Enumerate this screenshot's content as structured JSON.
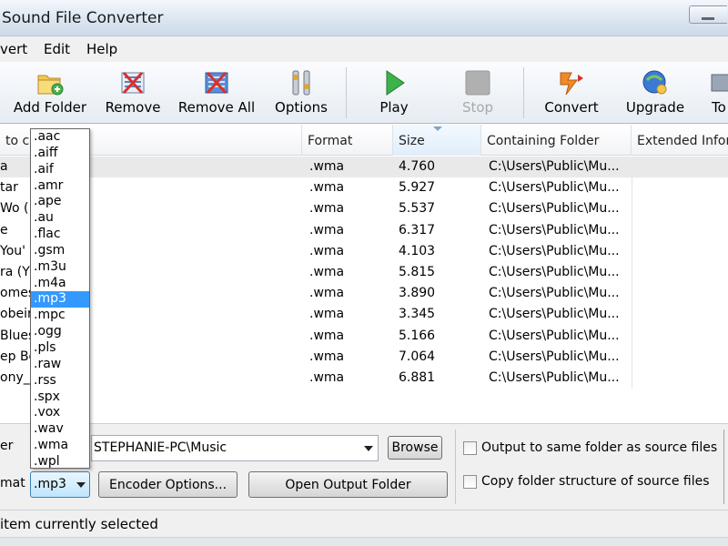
{
  "window": {
    "title": "Sound File Converter"
  },
  "menu": [
    "vert",
    "Edit",
    "Help"
  ],
  "toolbar": {
    "add_folder": "Add Folder",
    "remove": "Remove",
    "remove_all": "Remove All",
    "options": "Options",
    "play": "Play",
    "stop": "Stop",
    "convert": "Convert",
    "upgrade": "Upgrade",
    "tools_partial": "To"
  },
  "list": {
    "headers": {
      "name": "to co",
      "format": "Format",
      "size": "Size",
      "folder": "Containing Folder",
      "extended": "Extended Infor"
    },
    "rows": [
      {
        "name": "a",
        "format": ".wma",
        "size": "4.760",
        "folder": "C:\\Users\\Public\\Mu...",
        "selected": true
      },
      {
        "name": "tar",
        "format": ".wma",
        "size": "5.927",
        "folder": "C:\\Users\\Public\\Mu..."
      },
      {
        "name": "Wo (",
        "format": ".wma",
        "size": "5.537",
        "folder": "C:\\Users\\Public\\Mu..."
      },
      {
        "name": "e",
        "format": ".wma",
        "size": "6.317",
        "folder": "C:\\Users\\Public\\Mu..."
      },
      {
        "name": "You'",
        "format": ".wma",
        "size": "4.103",
        "folder": "C:\\Users\\Public\\Mu..."
      },
      {
        "name": "ra (Y",
        "format": ".wma",
        "size": "5.815",
        "folder": "C:\\Users\\Public\\Mu..."
      },
      {
        "name": "omes",
        "format": ".wma",
        "size": "3.890",
        "folder": "C:\\Users\\Public\\Mu..."
      },
      {
        "name": "obeir",
        "format": ".wma",
        "size": "3.345",
        "folder": "C:\\Users\\Public\\Mu..."
      },
      {
        "name": "Blues",
        "format": ".wma",
        "size": "5.166",
        "folder": "C:\\Users\\Public\\Mu..."
      },
      {
        "name": "ep Be",
        "format": ".wma",
        "size": "7.064",
        "folder": "C:\\Users\\Public\\Mu..."
      },
      {
        "name": "ony_N",
        "format": ".wma",
        "size": "6.881",
        "folder": "C:\\Users\\Public\\Mu..."
      }
    ]
  },
  "format_dropdown": {
    "options": [
      ".aac",
      ".aiff",
      ".aif",
      ".amr",
      ".ape",
      ".au",
      ".flac",
      ".gsm",
      ".m3u",
      ".m4a",
      ".mp3",
      ".mpc",
      ".ogg",
      ".pls",
      ".raw",
      ".rss",
      ".spx",
      ".vox",
      ".wav",
      ".wma",
      ".wpl"
    ],
    "highlighted": ".mp3"
  },
  "bottom": {
    "folder_label": "er",
    "output_folder": "STEPHANIE-PC\\Music",
    "browse": "Browse",
    "format_label": "mat",
    "format_value": ".mp3",
    "encoder_options": "Encoder Options...",
    "open_output_folder": "Open Output Folder",
    "same_folder": "Output to same folder as source files",
    "copy_structure": "Copy folder structure of source files"
  },
  "status": {
    "text": "item currently selected"
  },
  "colors": {
    "highlight": "#3399ff",
    "selected_row": "#e9e9e9"
  }
}
